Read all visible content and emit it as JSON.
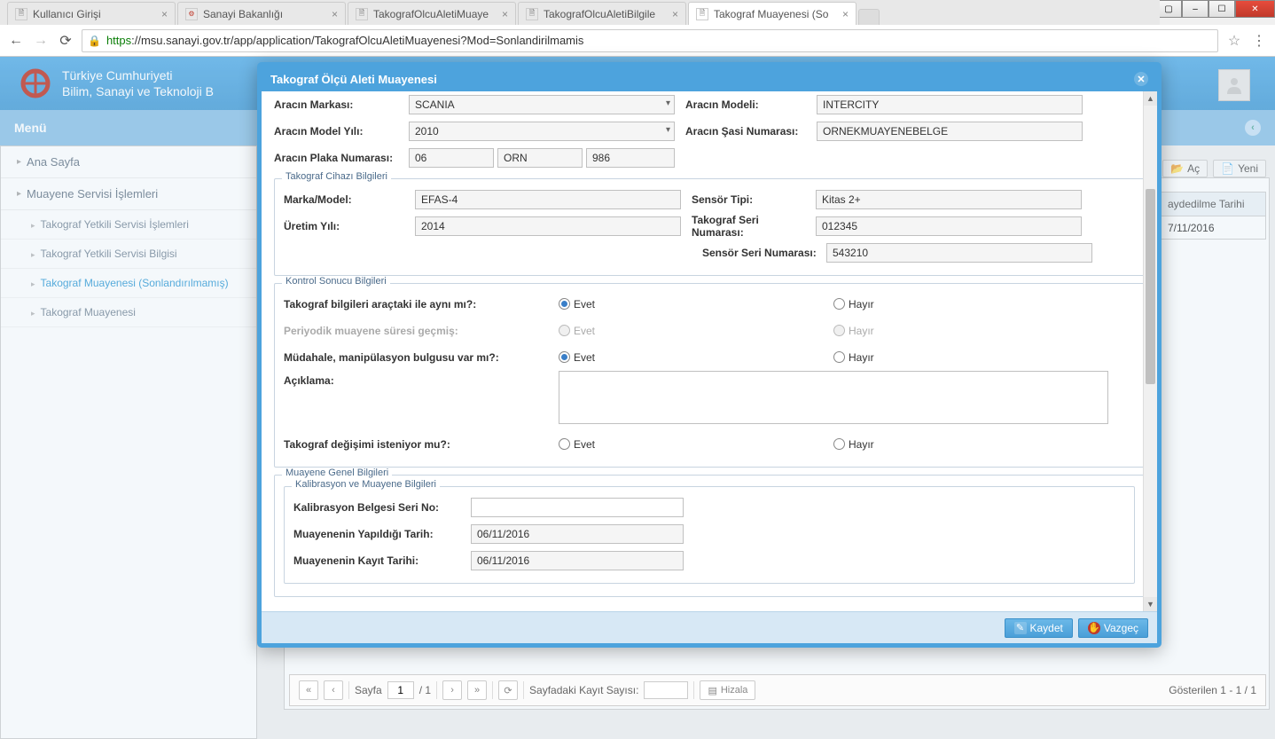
{
  "window": {
    "tabs": [
      {
        "label": "Kullanıcı Girişi"
      },
      {
        "label": "Sanayi Bakanlığı"
      },
      {
        "label": "TakografOlcuAletiMuaye"
      },
      {
        "label": "TakografOlcuAletiBilgile"
      },
      {
        "label": "Takograf Muayenesi (So"
      }
    ],
    "url_https": "https",
    "url_rest": "://msu.sanayi.gov.tr/app/application/TakografOlcuAletiMuayenesi?Mod=Sonlandirilmamis"
  },
  "app": {
    "title_line1": "Türkiye Cumhuriyeti",
    "title_line2": "Bilim, Sanayi ve Teknoloji B",
    "menu_label": "Menü"
  },
  "sidebar": {
    "items": [
      {
        "label": "Ana Sayfa"
      },
      {
        "label": "Muayene Servisi İşlemleri"
      }
    ],
    "subitems": [
      {
        "label": "Takograf Yetkili Servisi İşlemleri"
      },
      {
        "label": "Takograf Yetkili Servisi Bilgisi"
      },
      {
        "label": "Takograf Muayenesi (Sonlandırılmamış)",
        "active": true
      },
      {
        "label": "Takograf Muayenesi"
      }
    ]
  },
  "right_tools": {
    "open": "Aç",
    "new": "Yeni"
  },
  "grid": {
    "col": "aydedilme Tarihi",
    "row": "7/11/2016"
  },
  "pager": {
    "page_label": "Sayfa",
    "page_val": "1",
    "total": "/ 1",
    "per_label": "Sayfadaki Kayıt Sayısı:",
    "hizala": "Hizala",
    "shown": "Gösterilen 1 - 1 / 1"
  },
  "dialog": {
    "title": "Takograf Ölçü Aleti Muayenesi",
    "vehicle": {
      "marka_label": "Aracın Markası:",
      "marka_val": "SCANIA",
      "model_label": "Aracın Modeli:",
      "model_val": "INTERCITY",
      "modelyil_label": "Aracın Model Yılı:",
      "modelyil_val": "2010",
      "sasi_label": "Aracın Şasi Numarası:",
      "sasi_val": "ORNEKMUAYENEBELGE",
      "plaka_label": "Aracın Plaka Numarası:",
      "plaka_p1": "06",
      "plaka_p2": "ORN",
      "plaka_p3": "986"
    },
    "tako": {
      "legend": "Takograf Cihazı Bilgileri",
      "marka_label": "Marka/Model:",
      "marka_val": "EFAS-4",
      "sensor_label": "Sensör Tipi:",
      "sensor_val": "Kitas 2+",
      "uretim_label": "Üretim Yılı:",
      "uretim_val": "2014",
      "seri_label": "Takograf Seri Numarası:",
      "seri_val": "012345",
      "sensorseri_label": "Sensör Seri Numarası:",
      "sensorseri_val": "543210"
    },
    "kontrol": {
      "legend": "Kontrol Sonucu Bilgileri",
      "q1": "Takograf bilgileri araçtaki ile aynı mı?:",
      "q2": "Periyodik muayene süresi geçmiş:",
      "q3": "Müdahale, manipülasyon bulgusu var mı?:",
      "aciklama": "Açıklama:",
      "q4": "Takograf değişimi isteniyor mu?:",
      "evet": "Evet",
      "hayir": "Hayır"
    },
    "genel": {
      "legend": "Muayene Genel Bilgileri",
      "kalib_legend": "Kalibrasyon ve Muayene Bilgileri",
      "kalib_seri": "Kalibrasyon Belgesi Seri No:",
      "muay_tarih_label": "Muayenenin Yapıldığı Tarih:",
      "muay_tarih_val": "06/11/2016",
      "kayit_tarih_label": "Muayenenin Kayıt Tarihi:",
      "kayit_tarih_val": "06/11/2016"
    },
    "buttons": {
      "save": "Kaydet",
      "cancel": "Vazgeç"
    }
  }
}
